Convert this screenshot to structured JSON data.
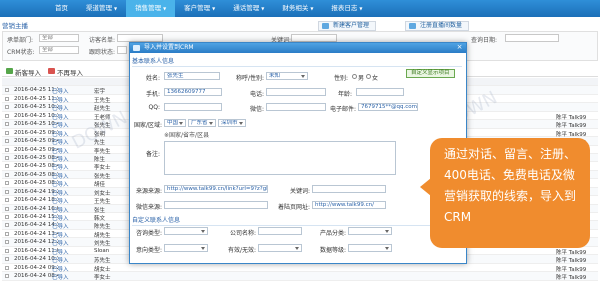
{
  "topnav": {
    "items": [
      {
        "label": "首页",
        "caret": ""
      },
      {
        "label": "渠道管理",
        "caret": "▼"
      },
      {
        "label": "销售管理",
        "caret": "▼"
      },
      {
        "label": "客户管理",
        "caret": "▼"
      },
      {
        "label": "通话管理",
        "caret": "▼"
      },
      {
        "label": "财务相关",
        "caret": "▼"
      },
      {
        "label": "报表日志",
        "caret": "▼"
      }
    ]
  },
  "page_title": "营销主播",
  "top_buttons": {
    "left": "新建客户管理",
    "right": "注册直播间数量"
  },
  "search": {
    "row1": [
      {
        "label": "承单部门:",
        "value": "全部"
      },
      {
        "label": "访客名单:",
        "value": ""
      },
      {
        "label": "关键词:",
        "value": ""
      },
      {
        "label": "查询日期:",
        "value": ""
      }
    ],
    "row2": [
      {
        "label": "CRM状态:",
        "value": "全部"
      },
      {
        "label": "跟踪状态:",
        "value": ""
      }
    ]
  },
  "toolbar": {
    "import": "新客导入",
    "not_import": "不再导入",
    "dialog_name": "所有客户"
  },
  "table": {
    "rows": [
      {
        "date": "2016-04-25 11:3",
        "src": "已导入",
        "name": "宏宇",
        "r1": "",
        "r2": "",
        "r3": ""
      },
      {
        "date": "2016-04-25 11:3",
        "src": "已导入",
        "name": "王先生",
        "r1": "",
        "r2": "",
        "r3": ""
      },
      {
        "date": "2016-04-25 10:2",
        "src": "已导入",
        "name": "赵先生",
        "r1": "",
        "r2": "",
        "r3": ""
      },
      {
        "date": "2016-04-25 10:3",
        "src": "已导入",
        "name": "王老师",
        "r1": "",
        "r2": "",
        "r3": "陈平 Talk99"
      },
      {
        "date": "2016-04-25 10:4",
        "src": "已导入",
        "name": "张先生",
        "r1": "",
        "r2": "",
        "r3": "陈平 Talk99"
      },
      {
        "date": "2016-04-25 09:3",
        "src": "已导入",
        "name": "张明",
        "r1": "",
        "r2": "",
        "r3": "陈平 Talk99"
      },
      {
        "date": "2016-04-25 09:4",
        "src": "已导入",
        "name": "先生",
        "r1": "",
        "r2": "",
        "r3": "陈平 Talk99"
      },
      {
        "date": "2016-04-25 09:4",
        "src": "已导入",
        "name": "李先生",
        "r1": "",
        "r2": "",
        "r3": "陈平 Talk99"
      },
      {
        "date": "2016-04-25 08:4",
        "src": "已导入",
        "name": "陈生",
        "r1": "",
        "r2": "",
        "r3": "陈平 Talk99"
      },
      {
        "date": "2016-04-25 08:4",
        "src": "已导入",
        "name": "李女士",
        "r1": "",
        "r2": "",
        "r3": "陈平 Talk99"
      },
      {
        "date": "2016-04-25 08:3",
        "src": "已导入",
        "name": "张先生",
        "r1": "",
        "r2": "",
        "r3": "陈平 Talk99"
      },
      {
        "date": "2016-04-25 08:3",
        "src": "已导入",
        "name": "胡佳",
        "r1": "",
        "r2": "",
        "r3": "陈平 Talk99"
      },
      {
        "date": "2016-04-24 19:2",
        "src": "已导入",
        "name": "刘女士",
        "r1": "",
        "r2": "",
        "r3": "陈平 Talk99"
      },
      {
        "date": "2016-04-24 18:3",
        "src": "已导入",
        "name": "王先生",
        "r1": "",
        "r2": "",
        "r3": "陈平 Talk99"
      },
      {
        "date": "2016-04-24 16:0",
        "src": "已导入",
        "name": "张生",
        "r1": "",
        "r2": "",
        "r3": "陈平 Talk99"
      },
      {
        "date": "2016-04-24 15:3",
        "src": "已导入",
        "name": "韩文",
        "r1": "",
        "r2": "",
        "r3": "陈平 Talk99"
      },
      {
        "date": "2016-04-24 14:3",
        "src": "已导入",
        "name": "陈先生",
        "r1": "",
        "r2": "",
        "r3": "陈平 Talk99"
      },
      {
        "date": "2016-04-24 13:4",
        "src": "已导入",
        "name": "胡先生",
        "r1": "",
        "r2": "",
        "r3": "陈平 Talk99"
      },
      {
        "date": "2016-04-24 12:2",
        "src": "已导入",
        "name": "刘先生",
        "r1": "",
        "r2": "",
        "r3": "陈平 Talk99"
      },
      {
        "date": "2016-04-24 11:0",
        "src": "已导入",
        "name": "Sloan",
        "r1": "",
        "r2": "",
        "r3": "陈平 Talk99"
      },
      {
        "date": "2016-04-24 10:3",
        "src": "已导入",
        "name": "苏先生",
        "r1": "",
        "r2": "",
        "r3": "陈平 Talk99"
      },
      {
        "date": "2016-04-24 09:2",
        "src": "已导入",
        "name": "胡女士",
        "r1": "",
        "r2": "",
        "r3": "陈平 Talk99"
      },
      {
        "date": "2016-04-24 08:4",
        "src": "已导入",
        "name": "李女士",
        "r1": "",
        "r2": "",
        "r3": "陈平 Talk99"
      }
    ]
  },
  "dialog": {
    "title": "导入并设置到CRM",
    "section_basic": "基本联系人信息",
    "custom_button": "自定义显示项目",
    "fields": {
      "name_label": "姓名:",
      "name_value": "张先生",
      "nick_label": "称呼/性别:",
      "nick_value": "未知",
      "gender_label": "性别:",
      "gender_male": "男",
      "gender_female": "女",
      "mobile_label": "手机:",
      "mobile_value": "13662609777",
      "phone_label": "电话:",
      "phone_value": "",
      "age_label": "年龄:",
      "age_value": "",
      "qq_label": "QQ:",
      "qq_value": "",
      "wechat_label": "微信:",
      "wechat_value": "",
      "email_label": "电子邮件:",
      "email_value": "7679715**@qq.com",
      "region_label": "国家/区域:",
      "country": "中国",
      "province": "广东省",
      "city": "深圳市",
      "region_hint": "※国家/省市/区县",
      "note_label": "备注:",
      "source_label": "来源来源:",
      "source_value": "http://www.talk99.cn/link?url=9?z?gb0sj",
      "keyword_label": "关键词:",
      "keyword_value": "",
      "wx_source_label": "微信来源:",
      "wx_source_value": "",
      "site_label": "着陆页网址:",
      "site_value": "http://www.talk99.cn/"
    },
    "section_custom": "自定义联系人信息",
    "custom_fields": [
      {
        "label": "咨询类型:",
        "value": ""
      },
      {
        "label": "公司名称:",
        "value": ""
      },
      {
        "label": "产品分类:",
        "value": ""
      },
      {
        "label": "意向类型:",
        "value": ""
      },
      {
        "label": "有效/无效:",
        "value": ""
      },
      {
        "label": "数据等级:",
        "value": ""
      }
    ]
  },
  "callout": {
    "text": "通过对话、留言、注册、400电话、免费电话及微营销获取的线索，导入到CRM"
  },
  "colors": {
    "nav": "#1b6fb8",
    "accent": "#2a62a8",
    "callout": "#f08c2e"
  }
}
